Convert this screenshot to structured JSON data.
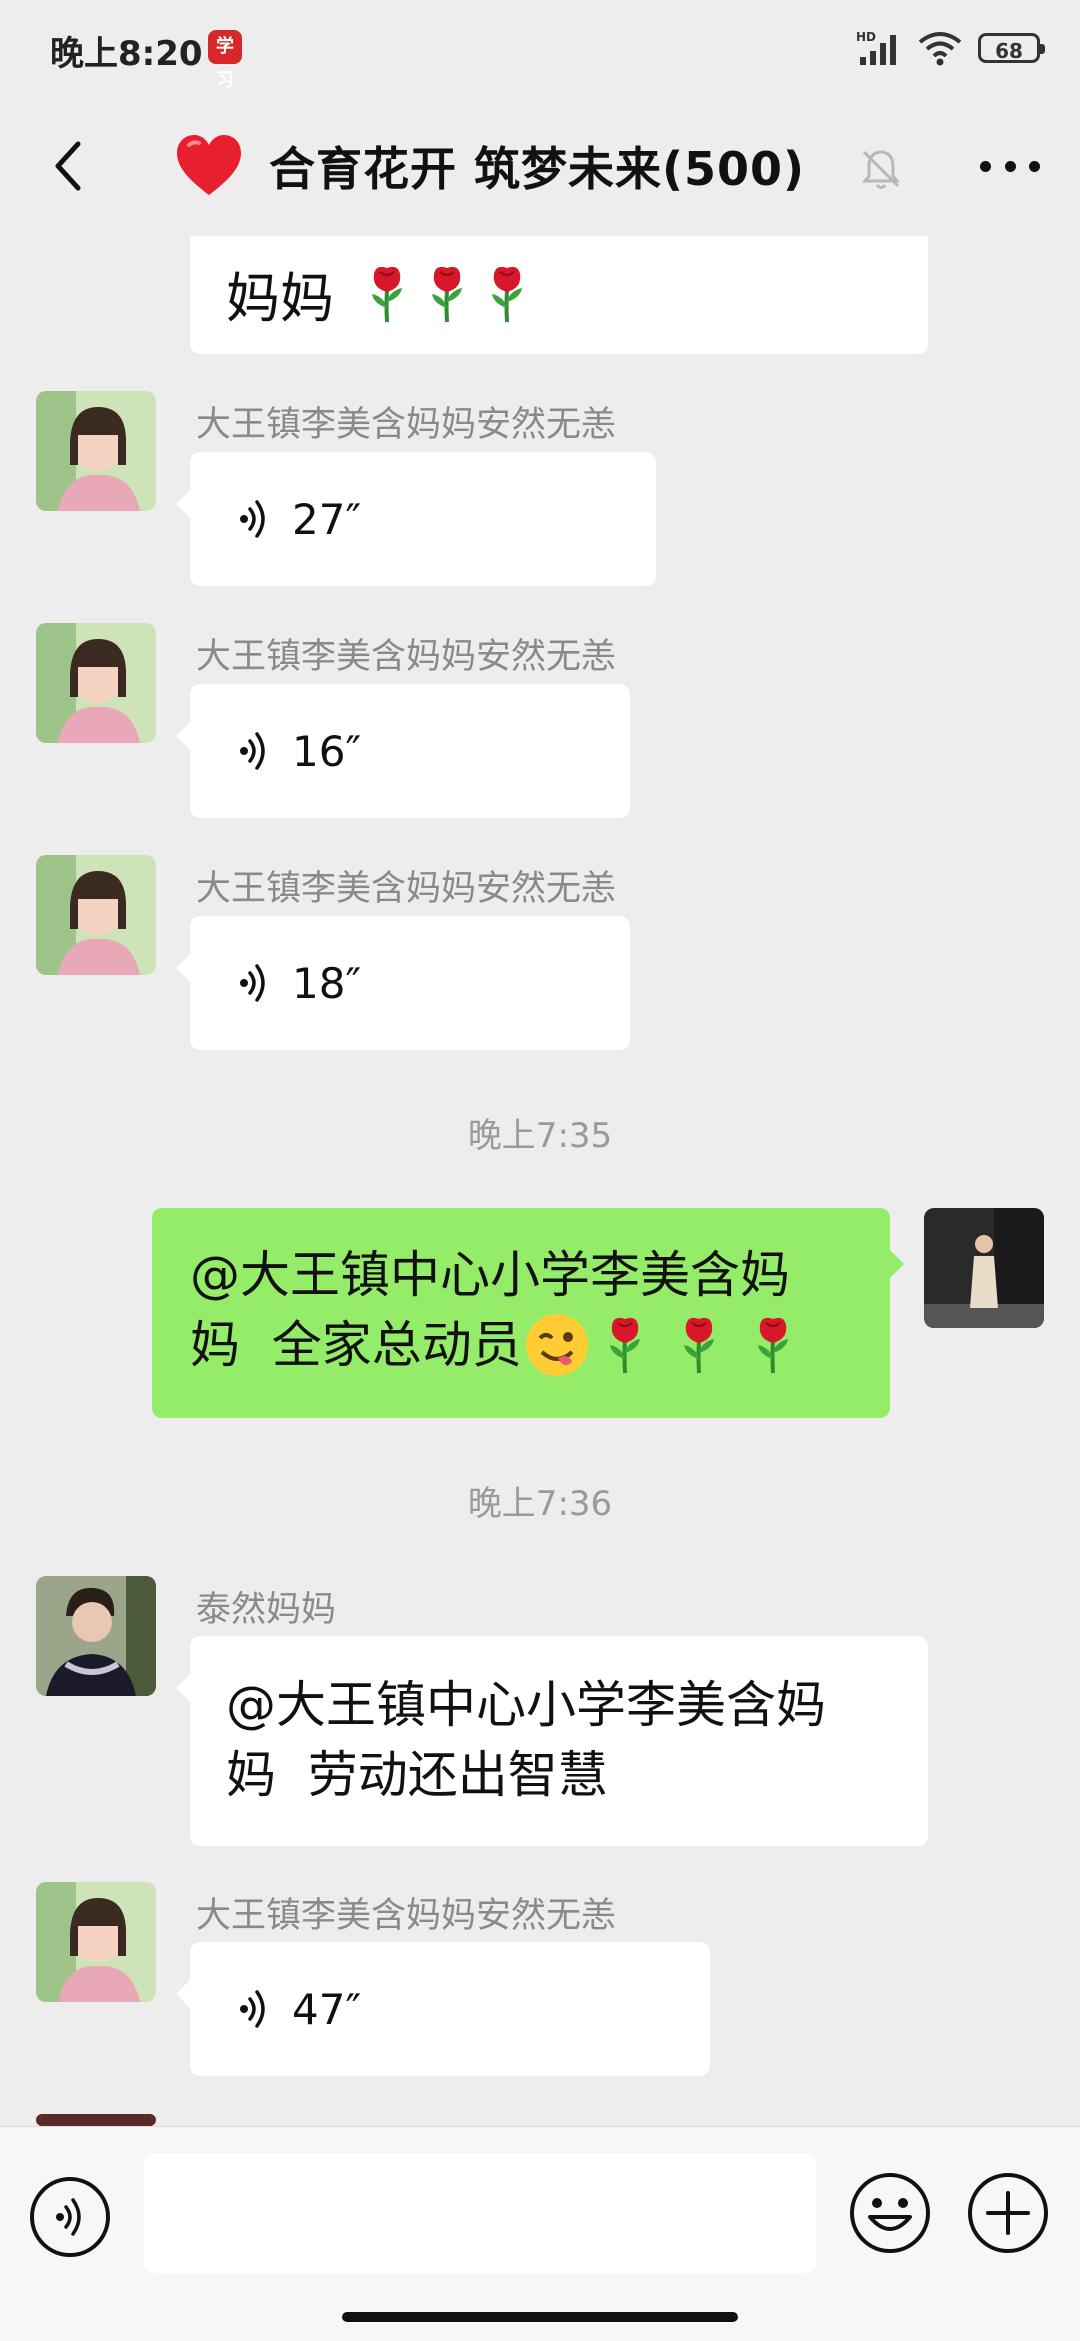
{
  "status_bar": {
    "time": "晚上8:20",
    "app_icon_text": "学习",
    "battery": "68",
    "network": "HD"
  },
  "header": {
    "title": "合育花开 筑梦未来(500)"
  },
  "messages": {
    "partial_text": "妈妈",
    "voice_1": {
      "sender": "大王镇李美含妈妈安然无恙",
      "duration": "27″"
    },
    "voice_2": {
      "sender": "大王镇李美含妈妈安然无恙",
      "duration": "16″"
    },
    "voice_3": {
      "sender": "大王镇李美含妈妈安然无恙",
      "duration": "18″"
    },
    "time_1": "晚上7:35",
    "self_msg": {
      "line1": "@大王镇中心小学李美含妈",
      "line2": "妈  全家总动员"
    },
    "time_2": "晚上7:36",
    "text_msg": {
      "sender": "泰然妈妈",
      "line1": "@大王镇中心小学李美含妈",
      "line2": "妈  劳动还出智慧"
    },
    "voice_4": {
      "sender": "大王镇李美含妈妈安然无恙",
      "duration": "47″"
    }
  },
  "icons": [
    "back-icon",
    "heart-icon",
    "mute-icon",
    "more-icon",
    "voice-icon",
    "emoji-icon",
    "plus-icon",
    "rose-icon",
    "wink-emoji-icon"
  ]
}
